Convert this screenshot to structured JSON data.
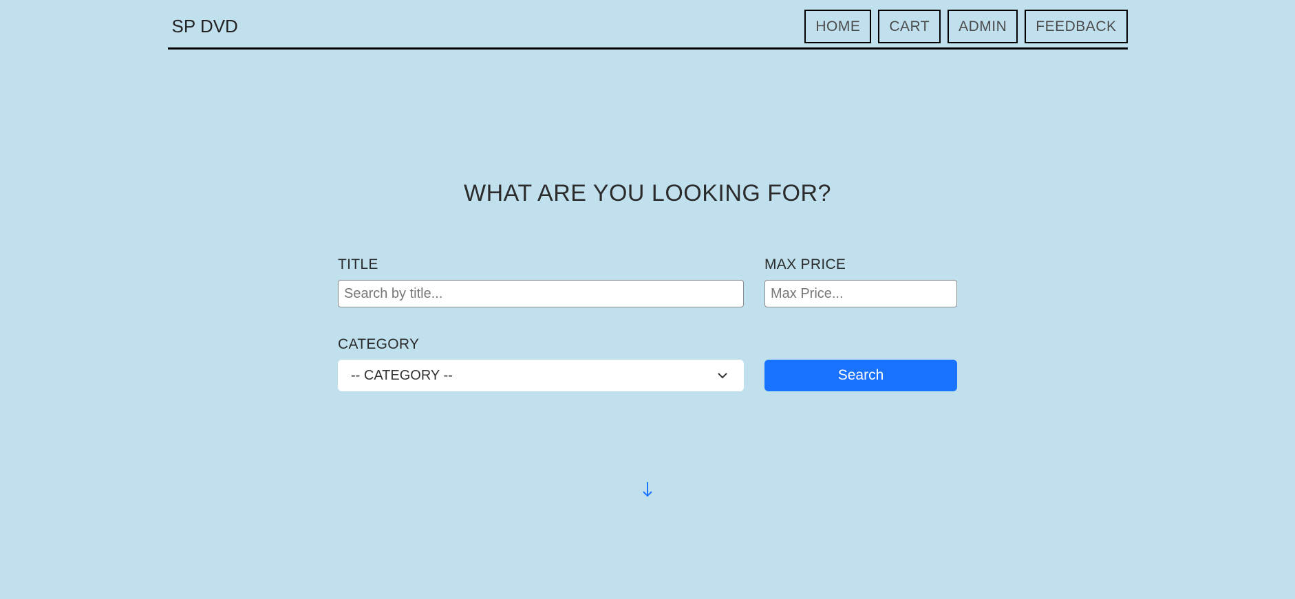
{
  "brand": "SP DVD",
  "nav": {
    "home": "HOME",
    "cart": "CART",
    "admin": "ADMIN",
    "feedback": "FEEDBACK"
  },
  "hero": {
    "heading": "WHAT ARE YOU LOOKING FOR?"
  },
  "form": {
    "title_label": "TITLE",
    "title_placeholder": "Search by title...",
    "maxprice_label": "MAX PRICE",
    "maxprice_placeholder": "Max Price...",
    "category_label": "CATEGORY",
    "category_selected": "-- CATEGORY --",
    "search_button": "Search"
  }
}
